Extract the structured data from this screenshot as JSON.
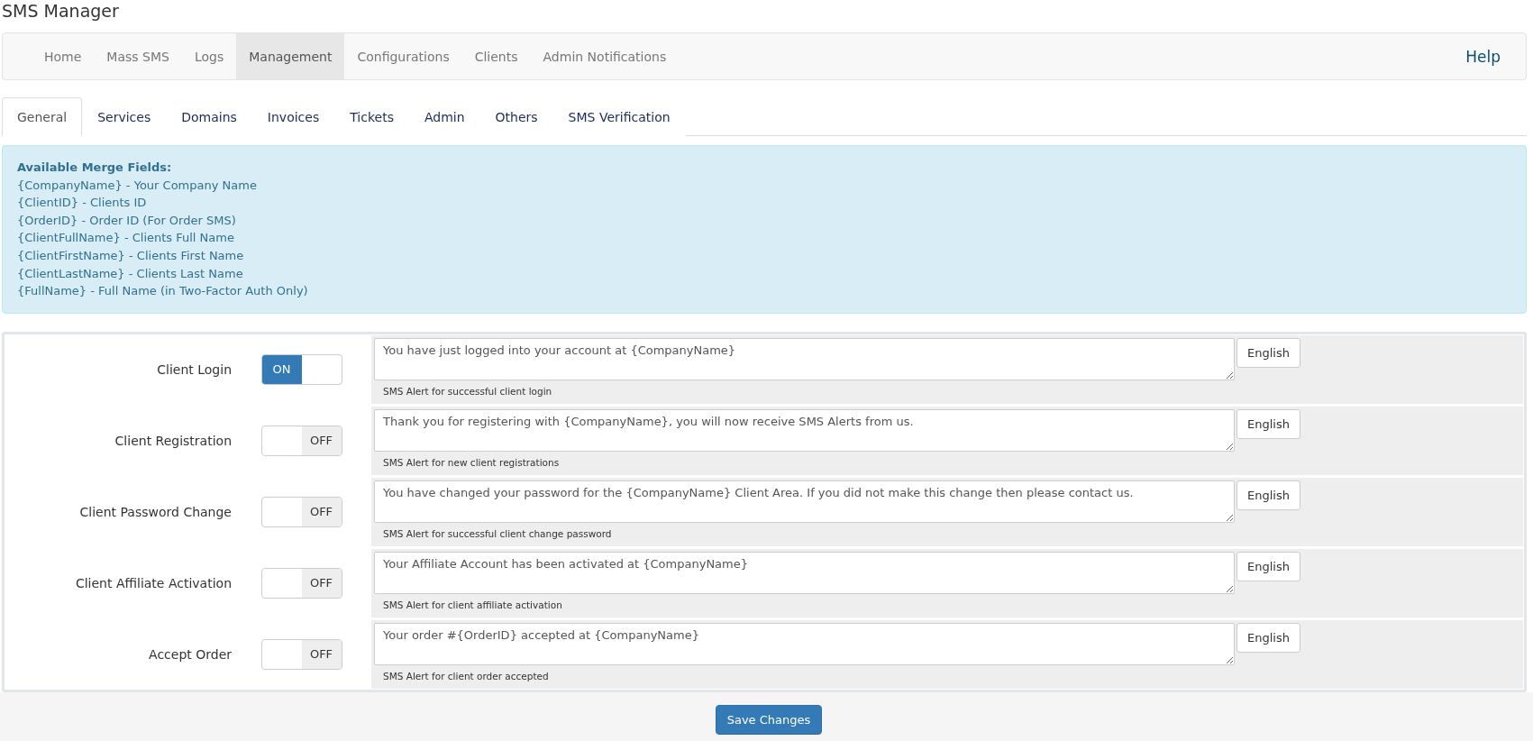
{
  "page_title": "SMS Manager",
  "nav": {
    "items": [
      {
        "label": "Home",
        "selected": false
      },
      {
        "label": "Mass SMS",
        "selected": false
      },
      {
        "label": "Logs",
        "selected": false
      },
      {
        "label": "Management",
        "selected": true
      },
      {
        "label": "Configurations",
        "selected": false
      },
      {
        "label": "Clients",
        "selected": false
      },
      {
        "label": "Admin Notifications",
        "selected": false
      }
    ],
    "help": "Help"
  },
  "tabs": [
    {
      "label": "General",
      "selected": true
    },
    {
      "label": "Services",
      "selected": false
    },
    {
      "label": "Domains",
      "selected": false
    },
    {
      "label": "Invoices",
      "selected": false
    },
    {
      "label": "Tickets",
      "selected": false
    },
    {
      "label": "Admin",
      "selected": false
    },
    {
      "label": "Others",
      "selected": false
    },
    {
      "label": "SMS Verification",
      "selected": false
    }
  ],
  "merge_fields": {
    "title": "Available Merge Fields:",
    "lines": [
      "{CompanyName} - Your Company Name",
      "{ClientID} - Clients ID",
      "{OrderID} - Order ID (For Order SMS)",
      "{ClientFullName} - Clients Full Name",
      "{ClientFirstName} - Clients First Name",
      "{ClientLastName} - Clients Last Name",
      "{FullName} - Full Name (in Two-Factor Auth Only)"
    ]
  },
  "alerts": [
    {
      "label": "Client Login",
      "on": true,
      "switch_text": "ON",
      "message": "You have just logged into your account at {CompanyName}",
      "hint": "SMS Alert for successful client login",
      "language": "English"
    },
    {
      "label": "Client Registration",
      "on": false,
      "switch_text": "OFF",
      "message": "Thank you for registering with {CompanyName}, you will now receive SMS Alerts from us.",
      "hint": "SMS Alert for new client registrations",
      "language": "English"
    },
    {
      "label": "Client Password Change",
      "on": false,
      "switch_text": "OFF",
      "message": "You have changed your password for the {CompanyName} Client Area. If you did not make this change then please contact us.",
      "hint": "SMS Alert for successful client change password",
      "language": "English"
    },
    {
      "label": "Client Affiliate Activation",
      "on": false,
      "switch_text": "OFF",
      "message": "Your Affiliate Account has been activated at {CompanyName}",
      "hint": "SMS Alert for client affiliate activation",
      "language": "English"
    },
    {
      "label": "Accept Order",
      "on": false,
      "switch_text": "OFF",
      "message": "Your order #{OrderID} accepted at {CompanyName}",
      "hint": "SMS Alert for client order accepted",
      "language": "English"
    }
  ],
  "save_button": "Save Changes"
}
